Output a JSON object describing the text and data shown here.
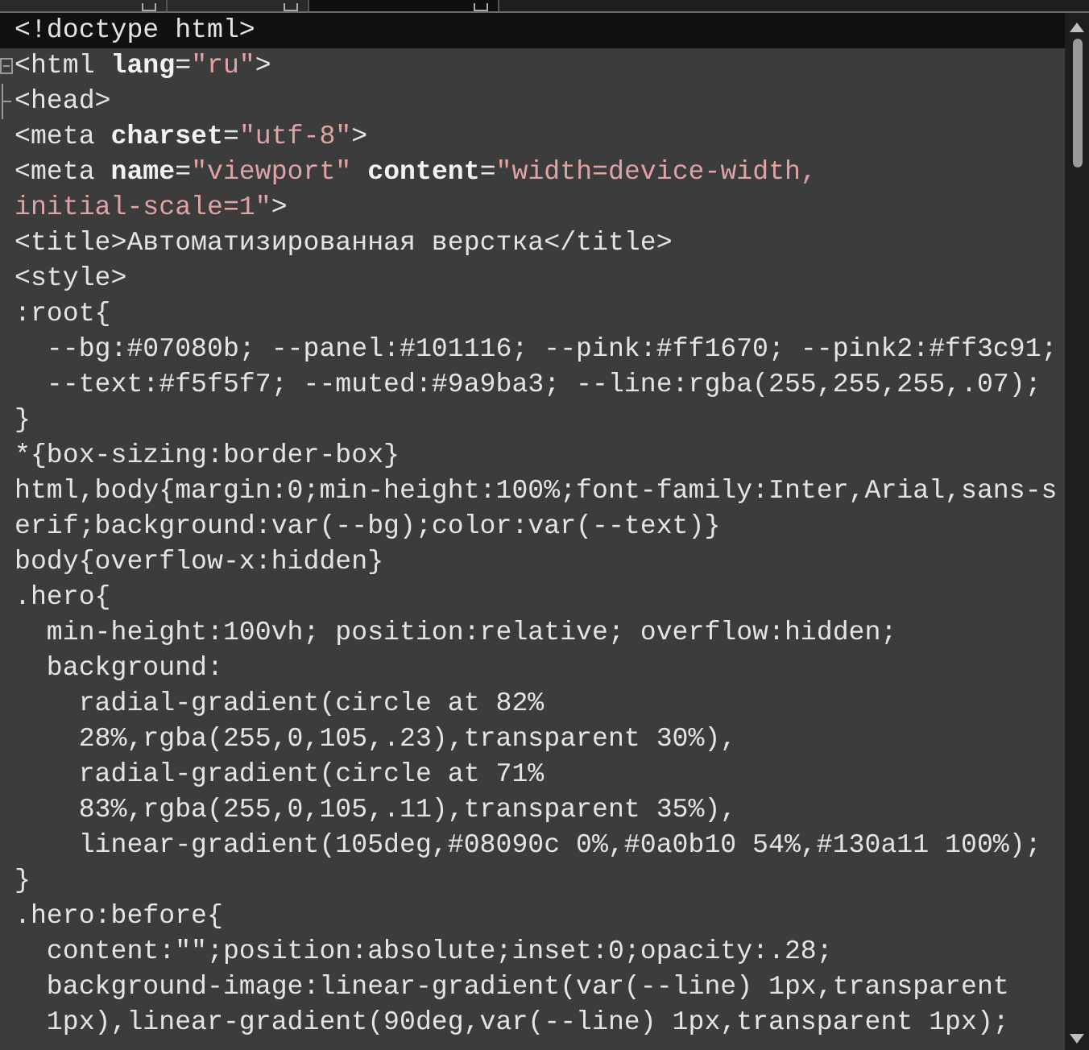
{
  "tabs": [
    {
      "selected": false
    },
    {
      "selected": false
    },
    {
      "selected": true
    }
  ],
  "editor": {
    "lines": [
      {
        "current": true,
        "fold_start": false,
        "fold_inside": false,
        "segments": [
          {
            "kind": "plain",
            "text": "<!doctype html>"
          }
        ]
      },
      {
        "current": false,
        "fold_start": true,
        "fold_inside": false,
        "segments": [
          {
            "kind": "plain",
            "text": "<html "
          },
          {
            "kind": "attr",
            "text": "lang"
          },
          {
            "kind": "plain",
            "text": "="
          },
          {
            "kind": "string",
            "text": "\"ru\""
          },
          {
            "kind": "plain",
            "text": ">"
          }
        ]
      },
      {
        "current": false,
        "fold_start": false,
        "fold_inside": true,
        "segments": [
          {
            "kind": "plain",
            "text": "<head>"
          }
        ]
      },
      {
        "current": false,
        "fold_start": false,
        "fold_inside": false,
        "segments": [
          {
            "kind": "plain",
            "text": "<meta "
          },
          {
            "kind": "attr",
            "text": "charset"
          },
          {
            "kind": "plain",
            "text": "="
          },
          {
            "kind": "string",
            "text": "\"utf-8\""
          },
          {
            "kind": "plain",
            "text": ">"
          }
        ]
      },
      {
        "current": false,
        "fold_start": false,
        "fold_inside": false,
        "segments": [
          {
            "kind": "plain",
            "text": "<meta "
          },
          {
            "kind": "attr",
            "text": "name"
          },
          {
            "kind": "plain",
            "text": "="
          },
          {
            "kind": "string",
            "text": "\"viewport\""
          },
          {
            "kind": "attr",
            "text": " content"
          },
          {
            "kind": "plain",
            "text": "="
          },
          {
            "kind": "string",
            "text": "\"width=device-width,"
          }
        ]
      },
      {
        "current": false,
        "fold_start": false,
        "fold_inside": false,
        "segments": [
          {
            "kind": "string",
            "text": "initial-scale=1\""
          },
          {
            "kind": "plain",
            "text": ">"
          }
        ]
      },
      {
        "current": false,
        "fold_start": false,
        "fold_inside": false,
        "segments": [
          {
            "kind": "plain",
            "text": "<title>Автоматизированная верстка</title>"
          }
        ]
      },
      {
        "current": false,
        "fold_start": false,
        "fold_inside": false,
        "segments": [
          {
            "kind": "plain",
            "text": "<style>"
          }
        ]
      },
      {
        "current": false,
        "fold_start": false,
        "fold_inside": false,
        "segments": [
          {
            "kind": "plain",
            "text": ":root{"
          }
        ]
      },
      {
        "current": false,
        "fold_start": false,
        "fold_inside": false,
        "segments": [
          {
            "kind": "plain",
            "text": "  --bg:#07080b; --panel:#101116; --pink:#ff1670; --pink2:#ff3c91;"
          }
        ]
      },
      {
        "current": false,
        "fold_start": false,
        "fold_inside": false,
        "segments": [
          {
            "kind": "plain",
            "text": "  --text:#f5f5f7; --muted:#9a9ba3; --line:rgba(255,255,255,.07);"
          }
        ]
      },
      {
        "current": false,
        "fold_start": false,
        "fold_inside": false,
        "segments": [
          {
            "kind": "plain",
            "text": "}"
          }
        ]
      },
      {
        "current": false,
        "fold_start": false,
        "fold_inside": false,
        "segments": [
          {
            "kind": "plain",
            "text": "*{box-sizing:border-box}"
          }
        ]
      },
      {
        "current": false,
        "fold_start": false,
        "fold_inside": false,
        "segments": [
          {
            "kind": "plain",
            "text": "html,body{margin:0;min-height:100%;font-family:Inter,Arial,sans-s"
          }
        ]
      },
      {
        "current": false,
        "fold_start": false,
        "fold_inside": false,
        "segments": [
          {
            "kind": "plain",
            "text": "erif;background:var(--bg);color:var(--text)}"
          }
        ]
      },
      {
        "current": false,
        "fold_start": false,
        "fold_inside": false,
        "segments": [
          {
            "kind": "plain",
            "text": "body{overflow-x:hidden}"
          }
        ]
      },
      {
        "current": false,
        "fold_start": false,
        "fold_inside": false,
        "segments": [
          {
            "kind": "plain",
            "text": ".hero{"
          }
        ]
      },
      {
        "current": false,
        "fold_start": false,
        "fold_inside": false,
        "segments": [
          {
            "kind": "plain",
            "text": "  min-height:100vh; position:relative; overflow:hidden;"
          }
        ]
      },
      {
        "current": false,
        "fold_start": false,
        "fold_inside": false,
        "segments": [
          {
            "kind": "plain",
            "text": "  background:"
          }
        ]
      },
      {
        "current": false,
        "fold_start": false,
        "fold_inside": false,
        "segments": [
          {
            "kind": "plain",
            "text": "    radial-gradient(circle at 82%"
          }
        ]
      },
      {
        "current": false,
        "fold_start": false,
        "fold_inside": false,
        "segments": [
          {
            "kind": "plain",
            "text": "    28%,rgba(255,0,105,.23),transparent 30%),"
          }
        ]
      },
      {
        "current": false,
        "fold_start": false,
        "fold_inside": false,
        "segments": [
          {
            "kind": "plain",
            "text": "    radial-gradient(circle at 71%"
          }
        ]
      },
      {
        "current": false,
        "fold_start": false,
        "fold_inside": false,
        "segments": [
          {
            "kind": "plain",
            "text": "    83%,rgba(255,0,105,.11),transparent 35%),"
          }
        ]
      },
      {
        "current": false,
        "fold_start": false,
        "fold_inside": false,
        "segments": [
          {
            "kind": "plain",
            "text": "    linear-gradient(105deg,#08090c 0%,#0a0b10 54%,#130a11 100%);"
          }
        ]
      },
      {
        "current": false,
        "fold_start": false,
        "fold_inside": false,
        "segments": [
          {
            "kind": "plain",
            "text": "}"
          }
        ]
      },
      {
        "current": false,
        "fold_start": false,
        "fold_inside": false,
        "segments": [
          {
            "kind": "plain",
            "text": ".hero:before{"
          }
        ]
      },
      {
        "current": false,
        "fold_start": false,
        "fold_inside": false,
        "segments": [
          {
            "kind": "plain",
            "text": "  content:\"\";position:absolute;inset:0;opacity:.28;"
          }
        ]
      },
      {
        "current": false,
        "fold_start": false,
        "fold_inside": false,
        "segments": [
          {
            "kind": "plain",
            "text": "  background-image:linear-gradient(var(--line) 1px,transparent"
          }
        ]
      },
      {
        "current": false,
        "fold_start": false,
        "fold_inside": false,
        "segments": [
          {
            "kind": "plain",
            "text": "  1px),linear-gradient(90deg,var(--line) 1px,transparent 1px);"
          }
        ]
      }
    ]
  }
}
